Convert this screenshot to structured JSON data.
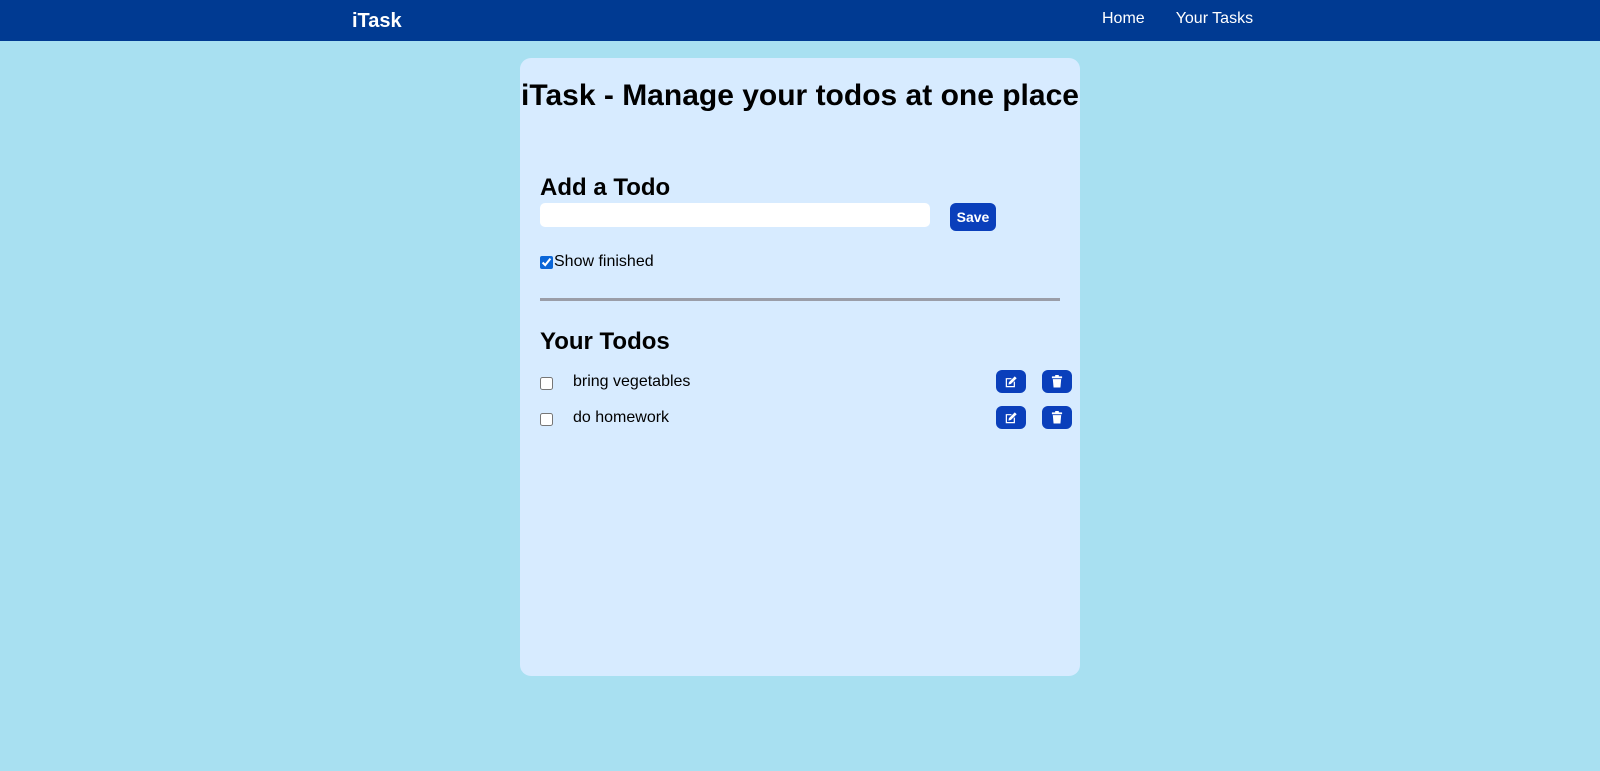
{
  "navbar": {
    "brand": "iTask",
    "links": [
      "Home",
      "Your Tasks"
    ]
  },
  "main": {
    "title": "iTask - Manage your todos at one place",
    "add_heading": "Add a Todo",
    "input_value": "",
    "save_label": "Save",
    "show_finished_label": "Show finished",
    "show_finished_checked": true,
    "todos_heading": "Your Todos",
    "todos": [
      {
        "text": "bring vegetables",
        "done": false
      },
      {
        "text": "do homework",
        "done": false
      }
    ]
  },
  "colors": {
    "page_bg": "#a8e0f1",
    "navbar_bg": "#003a92",
    "card_bg": "#d7ebff",
    "button_bg": "#0a3fbb"
  },
  "icons": {
    "edit": "edit-icon",
    "delete": "trash-icon"
  }
}
